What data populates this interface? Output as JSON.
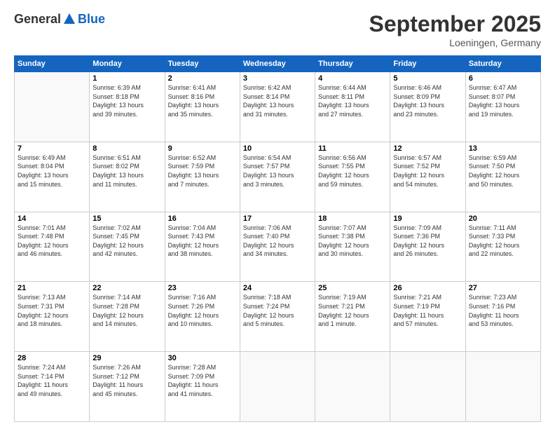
{
  "header": {
    "logo_general": "General",
    "logo_blue": "Blue",
    "month": "September 2025",
    "location": "Loeningen, Germany"
  },
  "weekdays": [
    "Sunday",
    "Monday",
    "Tuesday",
    "Wednesday",
    "Thursday",
    "Friday",
    "Saturday"
  ],
  "weeks": [
    [
      {
        "day": "",
        "info": ""
      },
      {
        "day": "1",
        "info": "Sunrise: 6:39 AM\nSunset: 8:18 PM\nDaylight: 13 hours\nand 39 minutes."
      },
      {
        "day": "2",
        "info": "Sunrise: 6:41 AM\nSunset: 8:16 PM\nDaylight: 13 hours\nand 35 minutes."
      },
      {
        "day": "3",
        "info": "Sunrise: 6:42 AM\nSunset: 8:14 PM\nDaylight: 13 hours\nand 31 minutes."
      },
      {
        "day": "4",
        "info": "Sunrise: 6:44 AM\nSunset: 8:11 PM\nDaylight: 13 hours\nand 27 minutes."
      },
      {
        "day": "5",
        "info": "Sunrise: 6:46 AM\nSunset: 8:09 PM\nDaylight: 13 hours\nand 23 minutes."
      },
      {
        "day": "6",
        "info": "Sunrise: 6:47 AM\nSunset: 8:07 PM\nDaylight: 13 hours\nand 19 minutes."
      }
    ],
    [
      {
        "day": "7",
        "info": "Sunrise: 6:49 AM\nSunset: 8:04 PM\nDaylight: 13 hours\nand 15 minutes."
      },
      {
        "day": "8",
        "info": "Sunrise: 6:51 AM\nSunset: 8:02 PM\nDaylight: 13 hours\nand 11 minutes."
      },
      {
        "day": "9",
        "info": "Sunrise: 6:52 AM\nSunset: 7:59 PM\nDaylight: 13 hours\nand 7 minutes."
      },
      {
        "day": "10",
        "info": "Sunrise: 6:54 AM\nSunset: 7:57 PM\nDaylight: 13 hours\nand 3 minutes."
      },
      {
        "day": "11",
        "info": "Sunrise: 6:56 AM\nSunset: 7:55 PM\nDaylight: 12 hours\nand 59 minutes."
      },
      {
        "day": "12",
        "info": "Sunrise: 6:57 AM\nSunset: 7:52 PM\nDaylight: 12 hours\nand 54 minutes."
      },
      {
        "day": "13",
        "info": "Sunrise: 6:59 AM\nSunset: 7:50 PM\nDaylight: 12 hours\nand 50 minutes."
      }
    ],
    [
      {
        "day": "14",
        "info": "Sunrise: 7:01 AM\nSunset: 7:48 PM\nDaylight: 12 hours\nand 46 minutes."
      },
      {
        "day": "15",
        "info": "Sunrise: 7:02 AM\nSunset: 7:45 PM\nDaylight: 12 hours\nand 42 minutes."
      },
      {
        "day": "16",
        "info": "Sunrise: 7:04 AM\nSunset: 7:43 PM\nDaylight: 12 hours\nand 38 minutes."
      },
      {
        "day": "17",
        "info": "Sunrise: 7:06 AM\nSunset: 7:40 PM\nDaylight: 12 hours\nand 34 minutes."
      },
      {
        "day": "18",
        "info": "Sunrise: 7:07 AM\nSunset: 7:38 PM\nDaylight: 12 hours\nand 30 minutes."
      },
      {
        "day": "19",
        "info": "Sunrise: 7:09 AM\nSunset: 7:36 PM\nDaylight: 12 hours\nand 26 minutes."
      },
      {
        "day": "20",
        "info": "Sunrise: 7:11 AM\nSunset: 7:33 PM\nDaylight: 12 hours\nand 22 minutes."
      }
    ],
    [
      {
        "day": "21",
        "info": "Sunrise: 7:13 AM\nSunset: 7:31 PM\nDaylight: 12 hours\nand 18 minutes."
      },
      {
        "day": "22",
        "info": "Sunrise: 7:14 AM\nSunset: 7:28 PM\nDaylight: 12 hours\nand 14 minutes."
      },
      {
        "day": "23",
        "info": "Sunrise: 7:16 AM\nSunset: 7:26 PM\nDaylight: 12 hours\nand 10 minutes."
      },
      {
        "day": "24",
        "info": "Sunrise: 7:18 AM\nSunset: 7:24 PM\nDaylight: 12 hours\nand 5 minutes."
      },
      {
        "day": "25",
        "info": "Sunrise: 7:19 AM\nSunset: 7:21 PM\nDaylight: 12 hours\nand 1 minute."
      },
      {
        "day": "26",
        "info": "Sunrise: 7:21 AM\nSunset: 7:19 PM\nDaylight: 11 hours\nand 57 minutes."
      },
      {
        "day": "27",
        "info": "Sunrise: 7:23 AM\nSunset: 7:16 PM\nDaylight: 11 hours\nand 53 minutes."
      }
    ],
    [
      {
        "day": "28",
        "info": "Sunrise: 7:24 AM\nSunset: 7:14 PM\nDaylight: 11 hours\nand 49 minutes."
      },
      {
        "day": "29",
        "info": "Sunrise: 7:26 AM\nSunset: 7:12 PM\nDaylight: 11 hours\nand 45 minutes."
      },
      {
        "day": "30",
        "info": "Sunrise: 7:28 AM\nSunset: 7:09 PM\nDaylight: 11 hours\nand 41 minutes."
      },
      {
        "day": "",
        "info": ""
      },
      {
        "day": "",
        "info": ""
      },
      {
        "day": "",
        "info": ""
      },
      {
        "day": "",
        "info": ""
      }
    ]
  ]
}
